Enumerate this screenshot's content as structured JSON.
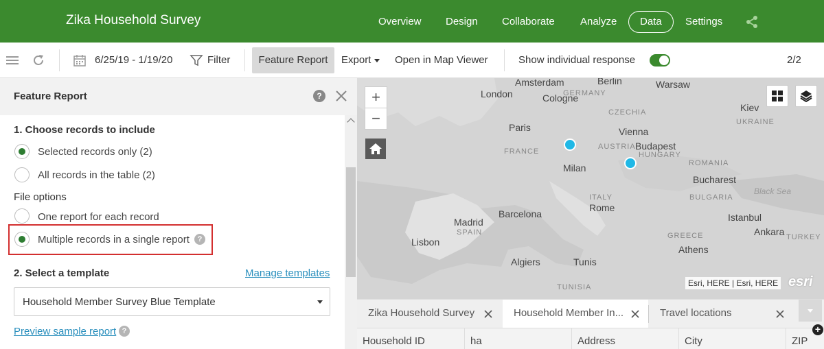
{
  "app": {
    "title": "Zika Household Survey",
    "nav": [
      {
        "label": "Overview"
      },
      {
        "label": "Design"
      },
      {
        "label": "Collaborate"
      },
      {
        "label": "Analyze"
      },
      {
        "label": "Data",
        "active": true
      },
      {
        "label": "Settings"
      }
    ],
    "brand_color": "#3b8a2e"
  },
  "toolbar": {
    "date_range": "6/25/19 - 1/19/20",
    "filter_label": "Filter",
    "feature_report_label": "Feature Report",
    "export_label": "Export",
    "open_map_viewer_label": "Open in Map Viewer",
    "show_individual_label": "Show individual response",
    "show_individual_on": true,
    "page_counter": "2/2"
  },
  "panel": {
    "title": "Feature Report",
    "section1_title": "1. Choose records to include",
    "records_options": [
      {
        "label": "Selected records only (2)",
        "checked": true
      },
      {
        "label": "All records in the table (2)",
        "checked": false
      }
    ],
    "file_options_title": "File options",
    "file_options": [
      {
        "label": "One report for each record",
        "checked": false
      },
      {
        "label": "Multiple records in a single report",
        "checked": true
      }
    ],
    "section2_title": "2. Select a template",
    "manage_templates_label": "Manage templates",
    "template_value": "Household Member Survey Blue Template",
    "preview_label": "Preview sample report"
  },
  "map": {
    "labels": [
      {
        "text": "Amsterdam",
        "kind": "city"
      },
      {
        "text": "Berlin",
        "kind": "city"
      },
      {
        "text": "Warsaw",
        "kind": "city"
      },
      {
        "text": "London",
        "kind": "city"
      },
      {
        "text": "GERMANY",
        "kind": "country"
      },
      {
        "text": "Cologne",
        "kind": "city"
      },
      {
        "text": "Kiev",
        "kind": "city"
      },
      {
        "text": "CZECHIA",
        "kind": "country"
      },
      {
        "text": "UKRAINE",
        "kind": "country"
      },
      {
        "text": "Paris",
        "kind": "city"
      },
      {
        "text": "Vienna",
        "kind": "city"
      },
      {
        "text": "FRANCE",
        "kind": "country"
      },
      {
        "text": "AUSTRIA",
        "kind": "country"
      },
      {
        "text": "Budapest",
        "kind": "city"
      },
      {
        "text": "HUNGARY",
        "kind": "country"
      },
      {
        "text": "Milan",
        "kind": "city"
      },
      {
        "text": "ROMANIA",
        "kind": "country"
      },
      {
        "text": "Bucharest",
        "kind": "city"
      },
      {
        "text": "ITALY",
        "kind": "country"
      },
      {
        "text": "Black Sea",
        "kind": "sea"
      },
      {
        "text": "BULGARIA",
        "kind": "country"
      },
      {
        "text": "Rome",
        "kind": "city"
      },
      {
        "text": "Barcelona",
        "kind": "city"
      },
      {
        "text": "Madrid",
        "kind": "city"
      },
      {
        "text": "Istanbul",
        "kind": "city"
      },
      {
        "text": "SPAIN",
        "kind": "country"
      },
      {
        "text": "Ankara",
        "kind": "city"
      },
      {
        "text": "Lisbon",
        "kind": "city"
      },
      {
        "text": "GREECE",
        "kind": "country"
      },
      {
        "text": "TURKEY",
        "kind": "country"
      },
      {
        "text": "Athens",
        "kind": "city"
      },
      {
        "text": "Algiers",
        "kind": "city"
      },
      {
        "text": "Tunis",
        "kind": "city"
      },
      {
        "text": "TUNISIA",
        "kind": "country"
      }
    ],
    "attribution": "Esri, HERE | Esri, HERE",
    "logo": "esri",
    "marker_color": "#1fb8e6"
  },
  "bottom_tabs": [
    {
      "label": "Zika Household Survey",
      "active": false
    },
    {
      "label": "Household Member In...",
      "active": true
    },
    {
      "label": "Travel locations",
      "active": false
    }
  ],
  "table": {
    "columns": [
      "Household ID",
      "ha",
      "Address",
      "City",
      "ZIP"
    ]
  }
}
